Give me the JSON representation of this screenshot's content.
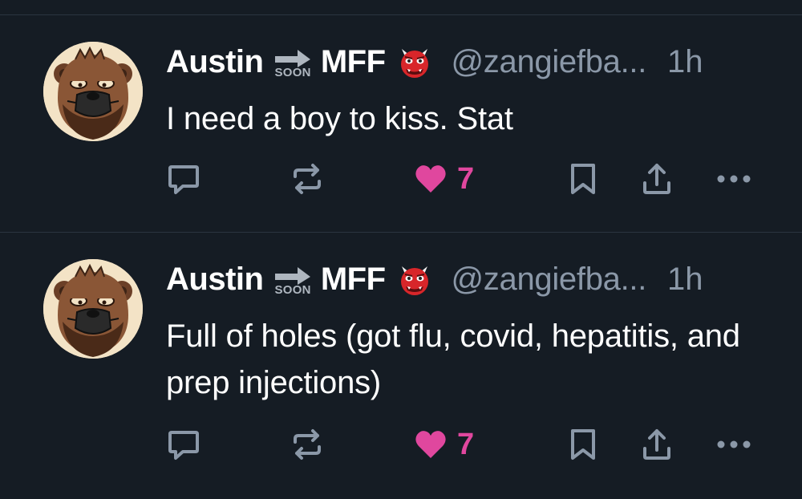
{
  "colors": {
    "background": "#151c24",
    "divider": "#2a3440",
    "name_text": "#ffffff",
    "muted_text": "#8b98a8",
    "icon": "#8b98a8",
    "like_pink": "#e0479e"
  },
  "posts": [
    {
      "display_name_left": "Austin",
      "soon_badge": "SOON",
      "display_name_right": "MFF",
      "name_emoji": "ogre-emoji",
      "handle": "@zangiefba...",
      "time": "1h",
      "text": "I need a boy to kiss. Stat",
      "likes": "7",
      "liked": true,
      "actions": [
        "reply-icon",
        "repost-icon",
        "heart-icon",
        "bookmark-icon",
        "share-icon",
        "more-icon"
      ]
    },
    {
      "display_name_left": "Austin",
      "soon_badge": "SOON",
      "display_name_right": "MFF",
      "name_emoji": "ogre-emoji",
      "handle": "@zangiefba...",
      "time": "1h",
      "text": "Full of holes (got flu, covid, hepatitis, and prep injections)",
      "likes": "7",
      "liked": true,
      "actions": [
        "reply-icon",
        "repost-icon",
        "heart-icon",
        "bookmark-icon",
        "share-icon",
        "more-icon"
      ]
    }
  ]
}
